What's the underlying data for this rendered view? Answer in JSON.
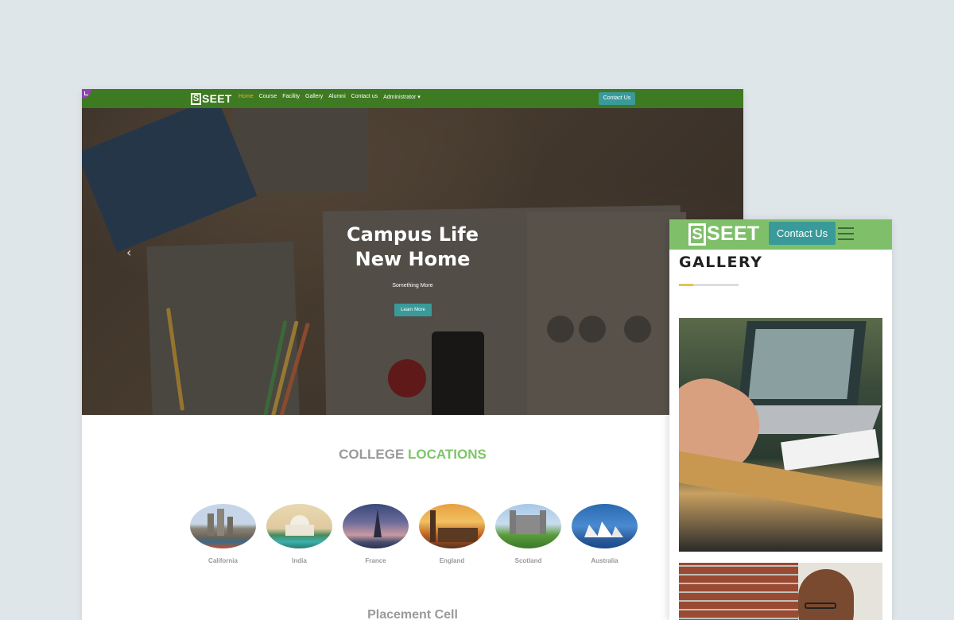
{
  "desktop": {
    "nav": {
      "logo_mark": "S",
      "logo_text": "SEET",
      "links": [
        "Home",
        "Course",
        "Facility",
        "Gallery",
        "Alumni",
        "Contact us",
        "Administrator ▾"
      ],
      "active_link": "Home",
      "contact_button": "Contact Us"
    },
    "hero": {
      "title_line1": "Campus Life",
      "title_line2": "New Home",
      "subtitle": "Something More",
      "button": "Learn More",
      "prev_arrow": "‹"
    },
    "locations": {
      "heading_part1": "COLLEGE ",
      "heading_part2": "LOCATIONS",
      "items": [
        {
          "name": "California",
          "icon": "california-skyline-image"
        },
        {
          "name": "India",
          "icon": "taj-mahal-image"
        },
        {
          "name": "France",
          "icon": "eiffel-tower-image"
        },
        {
          "name": "England",
          "icon": "big-ben-image"
        },
        {
          "name": "Scotland",
          "icon": "castle-image"
        },
        {
          "name": "Australia",
          "icon": "opera-house-image"
        }
      ]
    },
    "placement_heading": "Placement Cell"
  },
  "mobile": {
    "logo_mark": "S",
    "logo_text": "SEET",
    "contact_button": "Contact Us",
    "section_title": "GALLERY"
  },
  "colors": {
    "nav_green": "#3e7a22",
    "mobile_nav_green": "#7fbf6a",
    "teal_button": "#3a9a9a",
    "accent_green": "#7cc66a",
    "active_orange": "#f0a830",
    "underline_yellow": "#e8c250"
  }
}
